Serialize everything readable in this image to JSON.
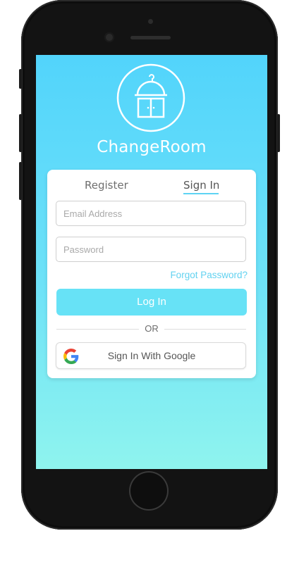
{
  "app": {
    "title": "ChangeRoom"
  },
  "tabs": {
    "register": "Register",
    "sign_in": "Sign In",
    "active": "sign_in"
  },
  "form": {
    "email_placeholder": "Email Address",
    "password_placeholder": "Password",
    "forgot": "Forgot Password?",
    "login": "Log In",
    "or": "OR",
    "google": "Sign In With Google"
  },
  "colors": {
    "accent": "#5ed3f3",
    "login_button": "#67e2f6",
    "screen_top": "#52d4fb",
    "screen_bottom": "#8ff4ee"
  },
  "icons": {
    "logo": "wardrobe-icon",
    "google": "google-icon"
  }
}
